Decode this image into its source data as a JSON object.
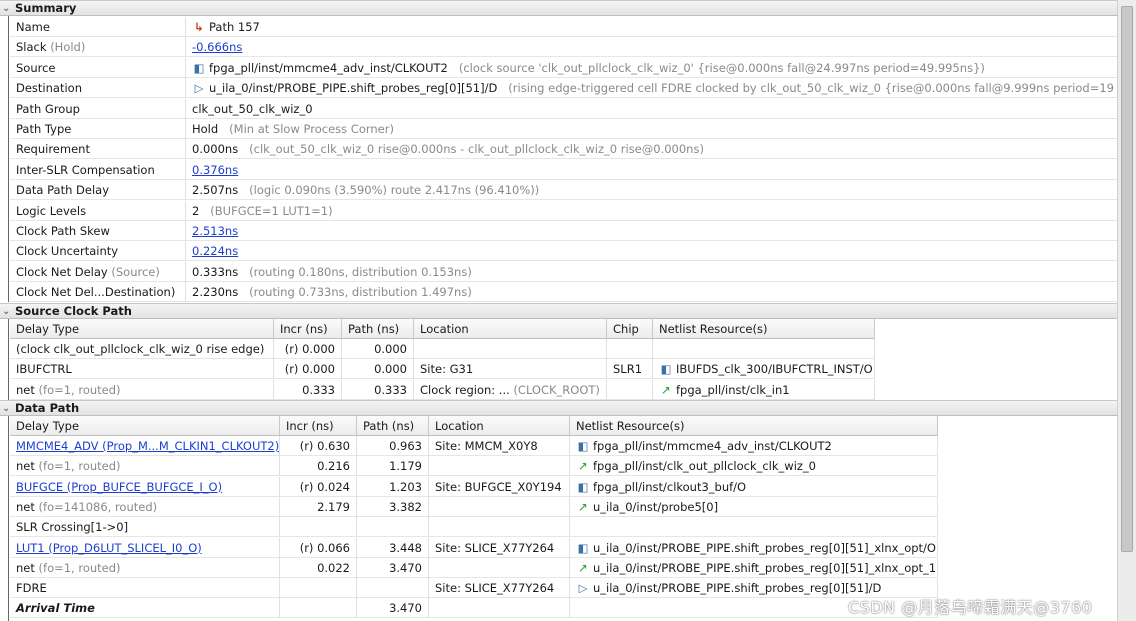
{
  "summary": {
    "title": "Summary",
    "rows": [
      {
        "label": "Name",
        "label_suffix": "",
        "icon": "path-icon",
        "value": "Path 157",
        "value_link": false,
        "detail": ""
      },
      {
        "label": "Slack",
        "label_suffix": "(Hold)",
        "icon": "",
        "value": "-0.666ns",
        "value_link": true,
        "detail": ""
      },
      {
        "label": "Source",
        "label_suffix": "",
        "icon": "source-cell-icon",
        "value": "fpga_pll/inst/mmcme4_adv_inst/CLKOUT2",
        "value_link": false,
        "detail": "(clock source 'clk_out_pllclock_clk_wiz_0'  {rise@0.000ns fall@24.997ns period=49.995ns})"
      },
      {
        "label": "Destination",
        "label_suffix": "",
        "icon": "destination-cell-icon",
        "value": "u_ila_0/inst/PROBE_PIPE.shift_probes_reg[0][51]/D",
        "value_link": false,
        "detail": "(rising edge-triggered cell FDRE clocked by clk_out_50_clk_wiz_0  {rise@0.000ns fall@9.999ns period=19"
      },
      {
        "label": "Path Group",
        "label_suffix": "",
        "icon": "",
        "value": "clk_out_50_clk_wiz_0",
        "value_link": false,
        "detail": ""
      },
      {
        "label": "Path Type",
        "label_suffix": "",
        "icon": "",
        "value": "Hold",
        "value_link": false,
        "detail": "(Min at Slow Process Corner)"
      },
      {
        "label": "Requirement",
        "label_suffix": "",
        "icon": "",
        "value": "0.000ns",
        "value_link": false,
        "detail": "(clk_out_50_clk_wiz_0 rise@0.000ns - clk_out_pllclock_clk_wiz_0 rise@0.000ns)"
      },
      {
        "label": "Inter-SLR Compensation",
        "label_suffix": "",
        "icon": "",
        "value": "0.376ns",
        "value_link": true,
        "detail": ""
      },
      {
        "label": "Data Path Delay",
        "label_suffix": "",
        "icon": "",
        "value": "2.507ns",
        "value_link": false,
        "detail": "(logic 0.090ns (3.590%)  route 2.417ns (96.410%))"
      },
      {
        "label": "Logic Levels",
        "label_suffix": "",
        "icon": "",
        "value": "2",
        "value_link": false,
        "detail": "(BUFGCE=1 LUT1=1)"
      },
      {
        "label": "Clock Path Skew",
        "label_suffix": "",
        "icon": "",
        "value": "2.513ns",
        "value_link": true,
        "detail": ""
      },
      {
        "label": "Clock Uncertainty",
        "label_suffix": "",
        "icon": "",
        "value": "0.224ns",
        "value_link": true,
        "detail": ""
      },
      {
        "label": "Clock Net Delay",
        "label_suffix": "(Source)",
        "icon": "",
        "value": "0.333ns",
        "value_link": false,
        "detail": "(routing 0.180ns, distribution 0.153ns)"
      },
      {
        "label": "Clock Net Del...Destination)",
        "label_suffix": "",
        "icon": "",
        "value": "2.230ns",
        "value_link": false,
        "detail": "(routing 0.733ns, distribution 1.497ns)"
      }
    ]
  },
  "source_clock_path": {
    "title": "Source Clock Path",
    "columns": [
      "Delay Type",
      "Incr (ns)",
      "Path (ns)",
      "Location",
      "Chip",
      "Netlist Resource(s)"
    ],
    "rows": [
      {
        "type": "(clock clk_out_pllclock_clk_wiz_0 rise edge)",
        "type_dim": "",
        "link": false,
        "incr": "(r) 0.000",
        "path": "0.000",
        "location": "",
        "location_dim": "",
        "chip": "",
        "icon": "",
        "resource": ""
      },
      {
        "type": "IBUFCTRL",
        "type_dim": "",
        "link": false,
        "incr": "(r) 0.000",
        "path": "0.000",
        "location": "Site: G31",
        "location_dim": "",
        "chip": "SLR1",
        "icon": "cell-icon",
        "resource": "IBUFDS_clk_300/IBUFCTRL_INST/O"
      },
      {
        "type": "net",
        "type_dim": "(fo=1, routed)",
        "link": false,
        "incr": "0.333",
        "path": "0.333",
        "location": "Clock region: ...",
        "location_dim": "(CLOCK_ROOT)",
        "chip": "",
        "icon": "net-icon",
        "resource": "fpga_pll/inst/clk_in1"
      }
    ]
  },
  "data_path": {
    "title": "Data Path",
    "columns": [
      "Delay Type",
      "Incr (ns)",
      "Path (ns)",
      "Location",
      "Netlist Resource(s)"
    ],
    "rows": [
      {
        "type": "MMCME4_ADV (Prop_M...M_CLKIN1_CLKOUT2)",
        "type_dim": "",
        "link": true,
        "bold": false,
        "incr": "(r) 0.630",
        "path": "0.963",
        "location": "Site: MMCM_X0Y8",
        "icon": "cell-icon",
        "resource": "fpga_pll/inst/mmcme4_adv_inst/CLKOUT2"
      },
      {
        "type": "net",
        "type_dim": "(fo=1, routed)",
        "link": false,
        "bold": false,
        "incr": "0.216",
        "path": "1.179",
        "location": "",
        "icon": "net-icon",
        "resource": "fpga_pll/inst/clk_out_pllclock_clk_wiz_0"
      },
      {
        "type": "BUFGCE (Prop_BUFCE_BUFGCE_I_O)",
        "type_dim": "",
        "link": true,
        "bold": false,
        "incr": "(r) 0.024",
        "path": "1.203",
        "location": "Site: BUFGCE_X0Y194",
        "icon": "cell-icon",
        "resource": "fpga_pll/inst/clkout3_buf/O"
      },
      {
        "type": "net",
        "type_dim": "(fo=141086, routed)",
        "link": false,
        "bold": false,
        "incr": "2.179",
        "path": "3.382",
        "location": "",
        "icon": "net-icon",
        "resource": "u_ila_0/inst/probe5[0]"
      },
      {
        "type": "SLR Crossing[1->0]",
        "type_dim": "",
        "link": false,
        "bold": false,
        "incr": "",
        "path": "",
        "location": "",
        "icon": "",
        "resource": ""
      },
      {
        "type": "LUT1 (Prop_D6LUT_SLICEL_I0_O)",
        "type_dim": "",
        "link": true,
        "bold": false,
        "incr": "(r) 0.066",
        "path": "3.448",
        "location": "Site: SLICE_X77Y264",
        "icon": "cell-icon",
        "resource": "u_ila_0/inst/PROBE_PIPE.shift_probes_reg[0][51]_xlnx_opt/O"
      },
      {
        "type": "net",
        "type_dim": "(fo=1, routed)",
        "link": false,
        "bold": false,
        "incr": "0.022",
        "path": "3.470",
        "location": "",
        "icon": "net-icon",
        "resource": "u_ila_0/inst/PROBE_PIPE.shift_probes_reg[0][51]_xlnx_opt_1"
      },
      {
        "type": "FDRE",
        "type_dim": "",
        "link": false,
        "bold": false,
        "incr": "",
        "path": "",
        "location": "Site: SLICE_X77Y264",
        "icon": "dest-icon",
        "resource": "u_ila_0/inst/PROBE_PIPE.shift_probes_reg[0][51]/D"
      },
      {
        "type": "Arrival Time",
        "type_dim": "",
        "link": false,
        "bold": true,
        "incr": "",
        "path": "3.470",
        "location": "",
        "icon": "",
        "resource": ""
      }
    ]
  },
  "icons": {
    "path-icon": "↳",
    "source-cell-icon": "◧",
    "destination-cell-icon": "▷",
    "cell-icon": "◧",
    "net-icon": "↗",
    "dest-icon": "▷"
  },
  "watermark": "CSDN @月落乌啼霜满天@3760"
}
